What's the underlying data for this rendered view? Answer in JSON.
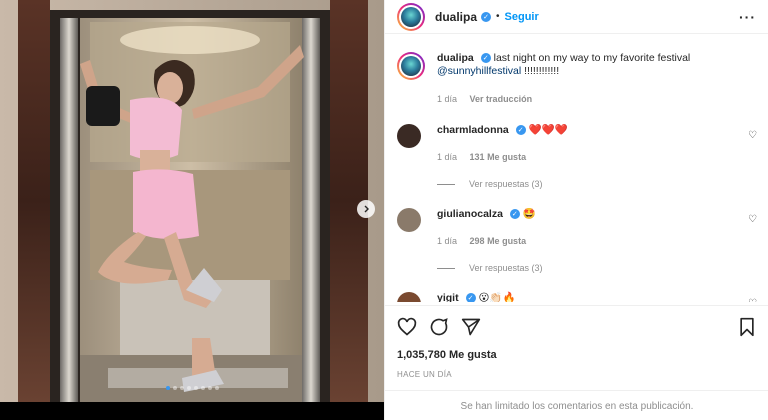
{
  "post": {
    "username": "dualipa",
    "follow_label": "Seguir",
    "dot": "•",
    "more_icon": "more-options-icon",
    "carousel": {
      "slide_count": 8,
      "active_index": 0
    }
  },
  "caption": {
    "username": "dualipa",
    "text": "last night on my way to my favorite festival",
    "mention": "@sunnyhillfestival",
    "tail": " !!!!!!!!!!!!",
    "time": "1 día",
    "translate": "Ver traducción"
  },
  "comments": [
    {
      "username": "charmladonna",
      "text": "❤️❤️❤️",
      "time": "1 día",
      "likes": "131 Me gusta",
      "replies": "Ver respuestas (3)",
      "avatar_color": "#3a2a24"
    },
    {
      "username": "giulianocalza",
      "text": "🤩",
      "time": "1 día",
      "likes": "298 Me gusta",
      "replies": "Ver respuestas (3)",
      "avatar_color": "#8a7a6a"
    },
    {
      "username": "yigit",
      "text": "😮👏🏻🔥",
      "avatar_color": "#7a4a30"
    }
  ],
  "actions": {
    "likes": "1,035,780 Me gusta",
    "time_ago": "HACE UN DÍA",
    "limited": "Se han limitado los comentarios en esta publicación."
  },
  "colors": {
    "accent": "#0095f6",
    "verified": "#3897f0",
    "muted": "#8e8e8e"
  }
}
